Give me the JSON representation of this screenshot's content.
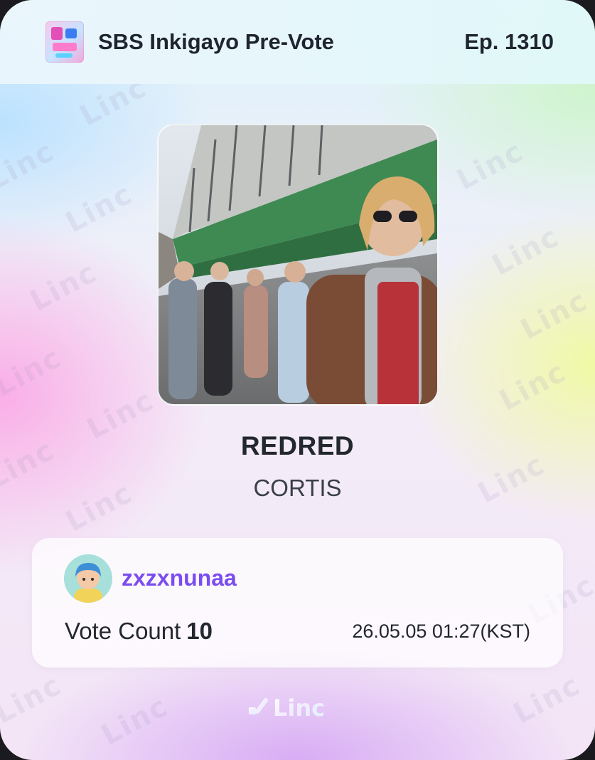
{
  "header": {
    "title": "SBS Inkigayo Pre-Vote",
    "episode": "Ep. 1310"
  },
  "song": {
    "title": "REDRED",
    "artist": "CORTIS"
  },
  "vote": {
    "username": "zxzxnunaa",
    "count_label": "Vote Count",
    "count": "10",
    "timestamp": "26.05.05 01:27(KST)"
  },
  "brand": {
    "watermark": "Linc",
    "footer_logo": "Linc"
  },
  "colors": {
    "username": "#7a4cf0",
    "text": "#23272f"
  }
}
